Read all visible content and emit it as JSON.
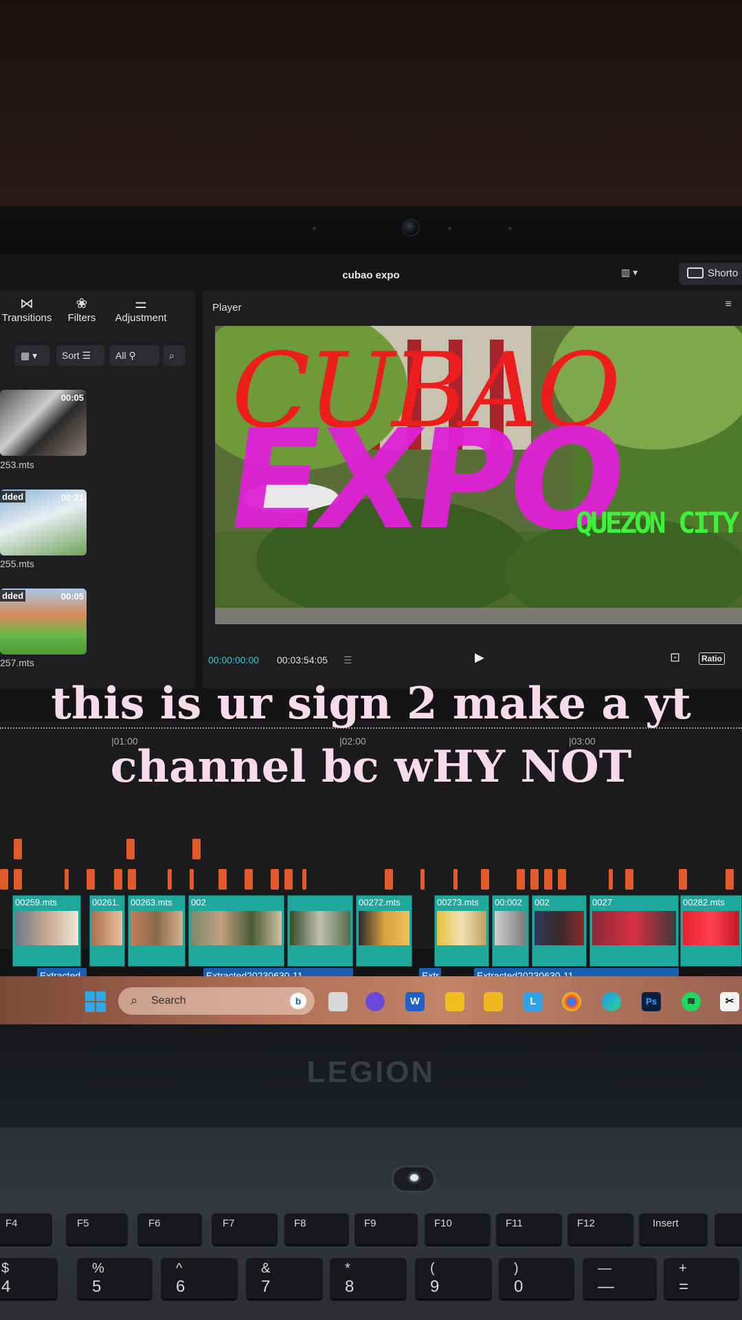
{
  "app": {
    "title": "cubao expo",
    "shortcut_label": "Shorto"
  },
  "toolbar": {
    "transitions_label": "Transitions",
    "filters_label": "Filters",
    "adjustment_label": "Adjustment"
  },
  "media_filters": {
    "sort_label": "Sort",
    "all_label": "All"
  },
  "media_clips": [
    {
      "duration": "00:05",
      "added": "",
      "name": "253.mts"
    },
    {
      "duration": "00:21",
      "added": "dded",
      "name": "255.mts"
    },
    {
      "duration": "00:05",
      "added": "dded",
      "name": "257.mts"
    }
  ],
  "player": {
    "label": "Player",
    "current_time": "00:00:00:00",
    "total_time": "00:03:54:05",
    "ratio_label": "Ratio",
    "title_red": "CUBAO",
    "title_pink": "EXPO",
    "subtitle_green": "QUEZON CITY"
  },
  "timeline": {
    "ruler": [
      "|01:00",
      "|02:00",
      "|03:00"
    ],
    "segments": [
      "00259.mts",
      "00261.",
      "00263.mts",
      "002",
      "00272.mts",
      "00273.mts",
      "00:002",
      "002",
      "0027",
      "00282.mts"
    ],
    "audio": [
      "Extracted",
      "Extracted20230630-11",
      "Extr",
      "Extracted20230630-11"
    ]
  },
  "taskbar": {
    "search_label": "Search"
  },
  "laptop": {
    "brand": "LEGION"
  },
  "keyboard": {
    "fkeys": [
      "F4",
      "F5",
      "F6",
      "F7",
      "F8",
      "F9",
      "F10",
      "F11",
      "F12",
      "Insert"
    ],
    "num_keys": [
      {
        "sym": "$",
        "n": "4"
      },
      {
        "sym": "%",
        "n": "5"
      },
      {
        "sym": "^",
        "n": "6"
      },
      {
        "sym": "&",
        "n": "7"
      },
      {
        "sym": "*",
        "n": "8"
      },
      {
        "sym": "(",
        "n": "9"
      },
      {
        "sym": ")",
        "n": "0"
      },
      {
        "sym": "—",
        "n": "—"
      },
      {
        "sym": "+",
        "n": "="
      }
    ]
  },
  "overlay": {
    "caption": "this is ur sign 2 make a yt channel bc wHY NOT"
  },
  "colors": {
    "accent_teal": "#1fa89c",
    "timecode": "#37c8d6",
    "marker": "#e25a2a",
    "caption": "#f8dbe8"
  }
}
